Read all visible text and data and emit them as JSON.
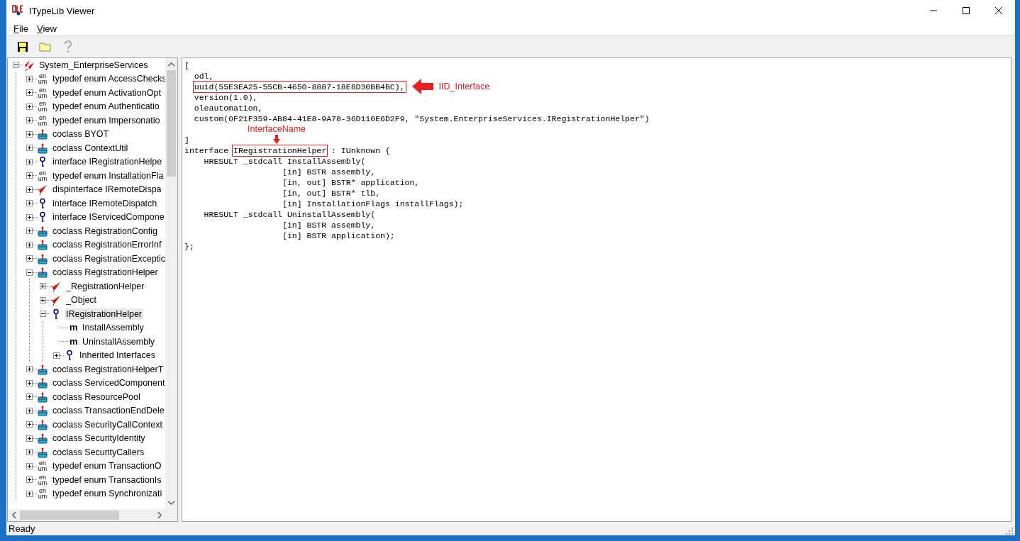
{
  "window": {
    "title": "ITypeLib Viewer"
  },
  "menu": [
    {
      "label": "File"
    },
    {
      "label": "View"
    }
  ],
  "toolbar": [
    {
      "kind": "save",
      "disabled": false
    },
    {
      "kind": "open",
      "disabled": false
    },
    {
      "kind": "help",
      "disabled": true
    }
  ],
  "tree": [
    {
      "label": "System_EnterpriseServices",
      "kind": "library",
      "expanded": true,
      "selected": false,
      "children": [
        {
          "label": "typedef enum AccessChecks",
          "kind": "enum",
          "glyph": [
            "en",
            "um"
          ],
          "expanded": false,
          "selected": false
        },
        {
          "label": "typedef enum ActivationOpt",
          "kind": "enum",
          "glyph": [
            "en",
            "um"
          ],
          "expanded": false,
          "selected": false
        },
        {
          "label": "typedef enum Authenticatio",
          "kind": "enum",
          "glyph": [
            "en",
            "um"
          ],
          "expanded": false,
          "selected": false
        },
        {
          "label": "typedef enum Impersonatio",
          "kind": "enum",
          "glyph": [
            "en",
            "um"
          ],
          "expanded": false,
          "selected": false
        },
        {
          "label": "coclass BYOT",
          "kind": "coclass",
          "expanded": false,
          "selected": false
        },
        {
          "label": "coclass ContextUtil",
          "kind": "coclass",
          "expanded": false,
          "selected": false
        },
        {
          "label": "interface IRegistrationHelpe",
          "kind": "interface",
          "expanded": false,
          "selected": false
        },
        {
          "label": "typedef enum InstallationFla",
          "kind": "enum",
          "glyph": [
            "en",
            "um"
          ],
          "expanded": false,
          "selected": false
        },
        {
          "label": "dispinterface IRemoteDispa",
          "kind": "dispinterface",
          "expanded": false,
          "selected": false
        },
        {
          "label": "interface IRemoteDispatch",
          "kind": "interface",
          "expanded": false,
          "selected": false
        },
        {
          "label": "interface IServicedCompone",
          "kind": "interface",
          "expanded": false,
          "selected": false
        },
        {
          "label": "coclass RegistrationConfig",
          "kind": "coclass",
          "expanded": false,
          "selected": false
        },
        {
          "label": "coclass RegistrationErrorInf",
          "kind": "coclass",
          "expanded": false,
          "selected": false
        },
        {
          "label": "coclass RegistrationExceptic",
          "kind": "coclass",
          "expanded": false,
          "selected": false
        },
        {
          "label": "coclass RegistrationHelper",
          "kind": "coclass",
          "expanded": true,
          "selected": false,
          "children": [
            {
              "label": "_RegistrationHelper",
              "kind": "dispinterface",
              "expanded": false,
              "selected": false
            },
            {
              "label": "_Object",
              "kind": "dispinterface",
              "expanded": false,
              "selected": false
            },
            {
              "label": "IRegistrationHelper",
              "kind": "interface",
              "expanded": true,
              "selected": true,
              "children": [
                {
                  "label": "InstallAssembly",
                  "kind": "method",
                  "glyph": [
                    "m"
                  ],
                  "selected": false
                },
                {
                  "label": "UninstallAssembly",
                  "kind": "method",
                  "glyph": [
                    "m"
                  ],
                  "selected": false
                },
                {
                  "label": "Inherited Interfaces",
                  "kind": "interface",
                  "expanded": false,
                  "selected": false
                }
              ]
            }
          ]
        },
        {
          "label": "coclass RegistrationHelperT",
          "kind": "coclass",
          "expanded": false,
          "selected": false
        },
        {
          "label": "coclass ServicedComponent",
          "kind": "coclass",
          "expanded": false,
          "selected": false
        },
        {
          "label": "coclass ResourcePool",
          "kind": "coclass",
          "expanded": false,
          "selected": false
        },
        {
          "label": "coclass TransactionEndDele",
          "kind": "coclass",
          "expanded": false,
          "selected": false
        },
        {
          "label": "coclass SecurityCallContext",
          "kind": "coclass",
          "expanded": false,
          "selected": false
        },
        {
          "label": "coclass SecurityIdentity",
          "kind": "coclass",
          "expanded": false,
          "selected": false
        },
        {
          "label": "coclass SecurityCallers",
          "kind": "coclass",
          "expanded": false,
          "selected": false
        },
        {
          "label": "typedef enum TransactionO",
          "kind": "enum",
          "glyph": [
            "en",
            "um"
          ],
          "expanded": false,
          "selected": false
        },
        {
          "label": "typedef enum TransactionIs",
          "kind": "enum",
          "glyph": [
            "en",
            "um"
          ],
          "expanded": false,
          "selected": false
        },
        {
          "label": "typedef enum Synchronizati",
          "kind": "enum",
          "glyph": [
            "en",
            "um"
          ],
          "expanded": false,
          "selected": false
        }
      ]
    }
  ],
  "code": [
    {
      "parts": [
        {
          "text": "["
        }
      ]
    },
    {
      "parts": [
        {
          "text": "  odl,"
        }
      ]
    },
    {
      "indented": true,
      "parts": [
        {
          "text": "uuid(55E3EA25-55CB-4650-8887-18E8D30BB4BC),",
          "boxed": true,
          "callout": {
            "kind": "left-arrow",
            "label": "IID_Interface"
          }
        }
      ]
    },
    {
      "parts": [
        {
          "text": "  version(1.0),"
        }
      ]
    },
    {
      "parts": [
        {
          "text": "  oleautomation,"
        }
      ]
    },
    {
      "parts": [
        {
          "text": "  custom(0F21F359-AB84-41E8-9A78-36D110E6D2F9, \"System.EnterpriseServices.IRegistrationHelper\")"
        }
      ]
    },
    {
      "blank": true
    },
    {
      "parts": [
        {
          "text": "]"
        }
      ]
    },
    {
      "parts": [
        {
          "text": "interface "
        },
        {
          "text": "IRegistrationHelper",
          "boxed": true,
          "callout": {
            "kind": "down-arrow",
            "label": "InterfaceName"
          }
        },
        {
          "text": " : IUnknown {"
        }
      ]
    },
    {
      "parts": [
        {
          "text": "    HRESULT _stdcall InstallAssembly("
        }
      ]
    },
    {
      "parts": [
        {
          "text": "                    [in] BSTR assembly,"
        }
      ]
    },
    {
      "parts": [
        {
          "text": "                    [in, out] BSTR* application,"
        }
      ]
    },
    {
      "parts": [
        {
          "text": "                    [in, out] BSTR* tlb,"
        }
      ]
    },
    {
      "parts": [
        {
          "text": "                    [in] InstallationFlags installFlags);"
        }
      ]
    },
    {
      "parts": [
        {
          "text": "    HRESULT _stdcall UninstallAssembly("
        }
      ]
    },
    {
      "parts": [
        {
          "text": "                    [in] BSTR assembly,"
        }
      ]
    },
    {
      "parts": [
        {
          "text": "                    [in] BSTR application);"
        }
      ]
    },
    {
      "parts": [
        {
          "text": "};"
        }
      ]
    }
  ],
  "status_bar": {
    "text": "Ready"
  }
}
